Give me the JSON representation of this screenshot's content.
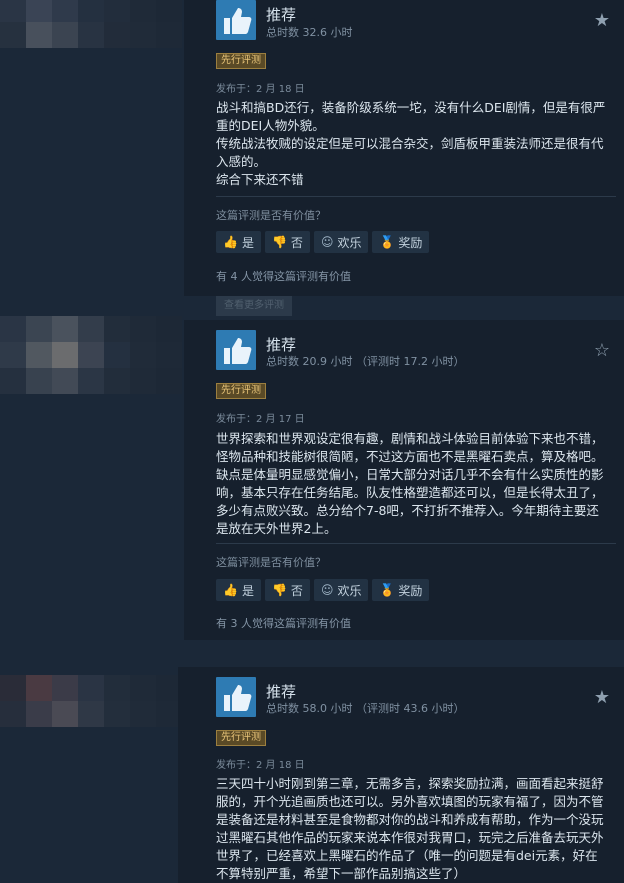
{
  "reviews": [
    {
      "recommendation": "推荐",
      "hours": "总时数 32.6 小时",
      "badge": "先行评测",
      "posted": "发布于：2 月 18 日",
      "paragraphs": [
        "战斗和搞BD还行，装备阶级系统一坨，没有什么DEI剧情，但是有很严重的DEI人物外貌。",
        "传统战法牧贼的设定但是可以混合杂交，剑盾板甲重装法师还是很有代入感的。",
        "综合下来还不错"
      ],
      "helpful_question": "这篇评测是否有价值？",
      "vote_yes": "是",
      "vote_no": "否",
      "vote_funny": "欢乐",
      "vote_award": "奖励",
      "helpful_count": "有 4 人觉得这篇评测有价值"
    },
    {
      "recommendation": "推荐",
      "hours": "总时数 20.9 小时 （评测时 17.2 小时）",
      "badge": "先行评测",
      "posted": "发布于：2 月 17 日",
      "paragraphs": [
        "世界探索和世界观设定很有趣，剧情和战斗体验目前体验下来也不错，怪物品种和技能树很简陋，不过这方面也不是黑曜石卖点，算及格吧。缺点是体量明显感觉偏小，日常大部分对话几乎不会有什么实质性的影响，基本只存在任务结尾。队友性格塑造都还可以，但是长得太丑了，多少有点败兴致。总分给个7-8吧，不打折不推荐入。今年期待主要还是放在天外世界2上。"
      ],
      "helpful_question": "这篇评测是否有价值？",
      "vote_yes": "是",
      "vote_no": "否",
      "vote_funny": "欢乐",
      "vote_award": "奖励",
      "helpful_count": "有 3 人觉得这篇评测有价值"
    },
    {
      "recommendation": "推荐",
      "hours": "总时数 58.0 小时 （评测时 43.6 小时）",
      "badge": "先行评测",
      "posted": "发布于：2 月 18 日",
      "paragraphs": [
        "三天四十小时刚到第三章，无需多言，探索奖励拉满，画面看起来挺舒服的，开个光追画质也还可以。另外喜欢填图的玩家有福了，因为不管是装备还是材料甚至是食物都对你的战斗和养成有帮助，作为一个没玩过黑曜石其他作品的玩家来说本作很对我胃口，玩完之后准备去玩天外世界了，已经喜欢上黑曜石的作品了（唯一的问题是有dei元素，好在不算特别严重，希望下一部作品别搞这些了）"
      ]
    }
  ],
  "more_button": "查看更多评测",
  "colors": {
    "background": "#1b2838",
    "card": "#16202d",
    "thumb": "#2e7bb3",
    "badge_text": "#e8c479"
  }
}
